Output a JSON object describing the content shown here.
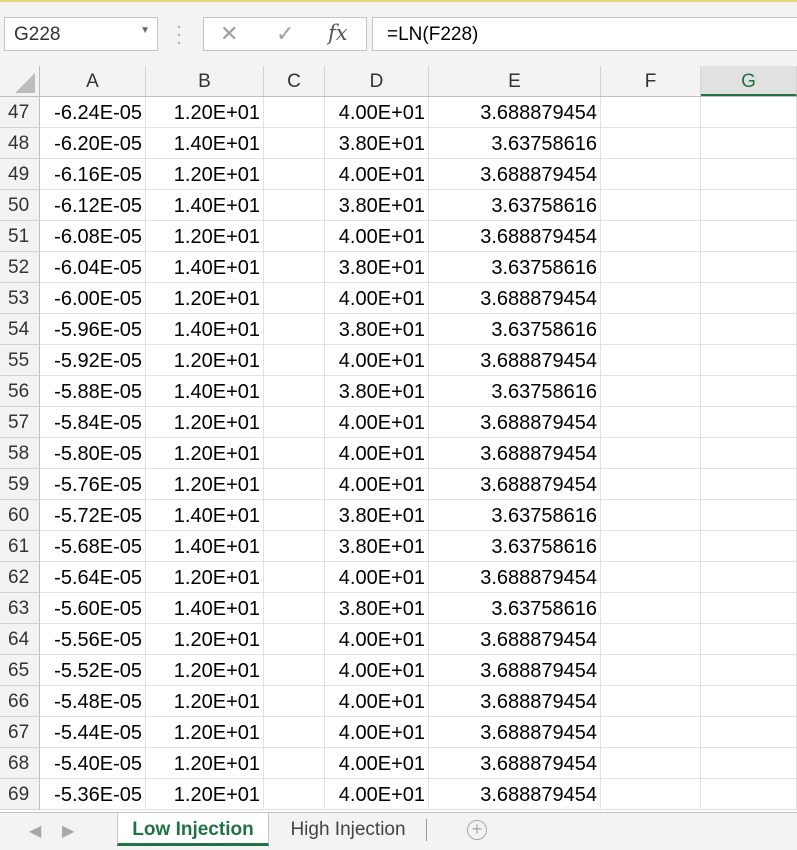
{
  "formula_bar": {
    "name_box": "G228",
    "cancel_icon": "✕",
    "enter_icon": "✓",
    "fx_label": "fx",
    "formula": "=LN(F228)"
  },
  "columns": [
    "A",
    "B",
    "C",
    "D",
    "E",
    "F",
    "G"
  ],
  "selected_column": "G",
  "rows": [
    {
      "num": "47",
      "A": "-6.24E-05",
      "B": "1.20E+01",
      "C": "",
      "D": "4.00E+01",
      "E": "3.688879454",
      "F": "",
      "G": ""
    },
    {
      "num": "48",
      "A": "-6.20E-05",
      "B": "1.40E+01",
      "C": "",
      "D": "3.80E+01",
      "E": "3.63758616",
      "F": "",
      "G": ""
    },
    {
      "num": "49",
      "A": "-6.16E-05",
      "B": "1.20E+01",
      "C": "",
      "D": "4.00E+01",
      "E": "3.688879454",
      "F": "",
      "G": ""
    },
    {
      "num": "50",
      "A": "-6.12E-05",
      "B": "1.40E+01",
      "C": "",
      "D": "3.80E+01",
      "E": "3.63758616",
      "F": "",
      "G": ""
    },
    {
      "num": "51",
      "A": "-6.08E-05",
      "B": "1.20E+01",
      "C": "",
      "D": "4.00E+01",
      "E": "3.688879454",
      "F": "",
      "G": ""
    },
    {
      "num": "52",
      "A": "-6.04E-05",
      "B": "1.40E+01",
      "C": "",
      "D": "3.80E+01",
      "E": "3.63758616",
      "F": "",
      "G": ""
    },
    {
      "num": "53",
      "A": "-6.00E-05",
      "B": "1.20E+01",
      "C": "",
      "D": "4.00E+01",
      "E": "3.688879454",
      "F": "",
      "G": ""
    },
    {
      "num": "54",
      "A": "-5.96E-05",
      "B": "1.40E+01",
      "C": "",
      "D": "3.80E+01",
      "E": "3.63758616",
      "F": "",
      "G": ""
    },
    {
      "num": "55",
      "A": "-5.92E-05",
      "B": "1.20E+01",
      "C": "",
      "D": "4.00E+01",
      "E": "3.688879454",
      "F": "",
      "G": ""
    },
    {
      "num": "56",
      "A": "-5.88E-05",
      "B": "1.40E+01",
      "C": "",
      "D": "3.80E+01",
      "E": "3.63758616",
      "F": "",
      "G": ""
    },
    {
      "num": "57",
      "A": "-5.84E-05",
      "B": "1.20E+01",
      "C": "",
      "D": "4.00E+01",
      "E": "3.688879454",
      "F": "",
      "G": ""
    },
    {
      "num": "58",
      "A": "-5.80E-05",
      "B": "1.20E+01",
      "C": "",
      "D": "4.00E+01",
      "E": "3.688879454",
      "F": "",
      "G": ""
    },
    {
      "num": "59",
      "A": "-5.76E-05",
      "B": "1.20E+01",
      "C": "",
      "D": "4.00E+01",
      "E": "3.688879454",
      "F": "",
      "G": ""
    },
    {
      "num": "60",
      "A": "-5.72E-05",
      "B": "1.40E+01",
      "C": "",
      "D": "3.80E+01",
      "E": "3.63758616",
      "F": "",
      "G": ""
    },
    {
      "num": "61",
      "A": "-5.68E-05",
      "B": "1.40E+01",
      "C": "",
      "D": "3.80E+01",
      "E": "3.63758616",
      "F": "",
      "G": ""
    },
    {
      "num": "62",
      "A": "-5.64E-05",
      "B": "1.20E+01",
      "C": "",
      "D": "4.00E+01",
      "E": "3.688879454",
      "F": "",
      "G": ""
    },
    {
      "num": "63",
      "A": "-5.60E-05",
      "B": "1.40E+01",
      "C": "",
      "D": "3.80E+01",
      "E": "3.63758616",
      "F": "",
      "G": ""
    },
    {
      "num": "64",
      "A": "-5.56E-05",
      "B": "1.20E+01",
      "C": "",
      "D": "4.00E+01",
      "E": "3.688879454",
      "F": "",
      "G": ""
    },
    {
      "num": "65",
      "A": "-5.52E-05",
      "B": "1.20E+01",
      "C": "",
      "D": "4.00E+01",
      "E": "3.688879454",
      "F": "",
      "G": ""
    },
    {
      "num": "66",
      "A": "-5.48E-05",
      "B": "1.20E+01",
      "C": "",
      "D": "4.00E+01",
      "E": "3.688879454",
      "F": "",
      "G": ""
    },
    {
      "num": "67",
      "A": "-5.44E-05",
      "B": "1.20E+01",
      "C": "",
      "D": "4.00E+01",
      "E": "3.688879454",
      "F": "",
      "G": ""
    },
    {
      "num": "68",
      "A": "-5.40E-05",
      "B": "1.20E+01",
      "C": "",
      "D": "4.00E+01",
      "E": "3.688879454",
      "F": "",
      "G": ""
    },
    {
      "num": "69",
      "A": "-5.36E-05",
      "B": "1.20E+01",
      "C": "",
      "D": "4.00E+01",
      "E": "3.688879454",
      "F": "",
      "G": ""
    }
  ],
  "sheet_tabs": [
    {
      "label": "Low Injection",
      "active": true
    },
    {
      "label": "High Injection",
      "active": false
    }
  ],
  "add_sheet_icon": "+",
  "colors": {
    "accent": "#217346"
  }
}
